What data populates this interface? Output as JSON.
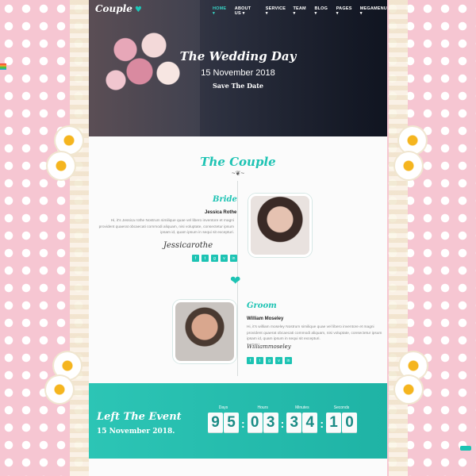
{
  "brand": {
    "name": "Couple",
    "icon": "heart-footprints-icon"
  },
  "nav": {
    "items": [
      {
        "label": "HOME ▾",
        "active": true
      },
      {
        "label": "ABOUT US ▾",
        "active": false
      },
      {
        "label": "SERVICE ▾",
        "active": false
      },
      {
        "label": "TEAM ▾",
        "active": false
      },
      {
        "label": "BLOG ▾",
        "active": false
      },
      {
        "label": "PAGES ▾",
        "active": false
      },
      {
        "label": "MEGAMENU ▾",
        "active": false
      }
    ]
  },
  "hero": {
    "title": "The Wedding Day",
    "date": "15 November 2018",
    "cta": "Save The Date"
  },
  "couple": {
    "title": "The Couple",
    "bride": {
      "role": "Bride",
      "name": "Jessica Rothe",
      "desc": "Hi, it's Jessica rothe Nostrum similique quae vel libero inventore et magni provident quaerat obcaecati commodi aliquam, nisi voluptate, consectetur ipsum ipsam id, quam ipsum in sequi sit excepturi.",
      "signature": "Jessicarothe"
    },
    "groom": {
      "role": "Groom",
      "name": "William Moseley",
      "desc": "Hi, it's william moseley Nostrum similique quae vel libero inventore et magni provident quaerat obcaecati commodi aliquam, nisi voluptate, consectetur ipsum ipsam id, quam ipsum in sequi sit excepturi.",
      "signature": "Williammoseley"
    },
    "socials": [
      "f",
      "t",
      "g",
      "v",
      "in"
    ]
  },
  "countdown": {
    "title": "Left The Event",
    "date": "15 November 2018.",
    "labels": {
      "days": "Days",
      "hours": "Hours",
      "minutes": "Minutes",
      "seconds": "Seconds"
    },
    "days": [
      "9",
      "5"
    ],
    "hours": [
      "0",
      "3"
    ],
    "minutes": [
      "3",
      "4"
    ],
    "seconds": [
      "1",
      "0"
    ]
  },
  "colors": {
    "accent": "#1dc3b3",
    "pink": "#f6c6d2"
  }
}
